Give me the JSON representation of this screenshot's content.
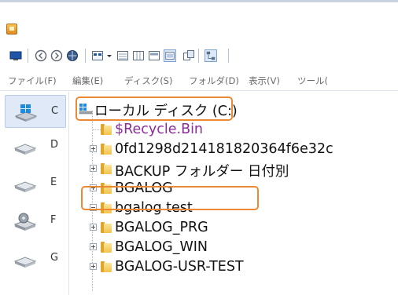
{
  "toolbar": {
    "icons": [
      "monitor-icon",
      "back-icon",
      "forward-icon",
      "globe-icon",
      "view-icon",
      "dropdown-icon",
      "view-list-icon",
      "view-details-icon",
      "view-small-icon",
      "view-large-icon",
      "copy-icon",
      "network-icon"
    ]
  },
  "menu": {
    "items": [
      "ファイル(F)",
      "編集(E)",
      "ディスク(S)",
      "フォルダ(D)",
      "表示(V)",
      "ツール("
    ]
  },
  "drives": [
    {
      "letter": "C",
      "icon": "windows-drive-icon",
      "selected": true
    },
    {
      "letter": "D",
      "icon": "hard-drive-icon",
      "selected": false
    },
    {
      "letter": "E",
      "icon": "hard-drive-icon",
      "selected": false
    },
    {
      "letter": "F",
      "icon": "dvd-drive-icon",
      "selected": false
    },
    {
      "letter": "G",
      "icon": "hard-drive-icon",
      "selected": false
    }
  ],
  "tree": {
    "root": {
      "label": "ローカル ディスク (C:)",
      "icon": "local-disk-icon"
    },
    "children": [
      {
        "label": "$Recycle.Bin",
        "expander": "none"
      },
      {
        "label": "0fd1298d214181820364f6e32c",
        "expander": "plus"
      },
      {
        "label": "BACKUP フォルダー 日付別",
        "expander": "plus"
      },
      {
        "label": "BGALOG",
        "expander": "plus"
      },
      {
        "label": "bgalog test",
        "expander": "minus"
      },
      {
        "label": "BGALOG_PRG",
        "expander": "plus"
      },
      {
        "label": "BGALOG_WIN",
        "expander": "plus"
      },
      {
        "label": "BGALOG-USR-TEST",
        "expander": "plus"
      }
    ]
  },
  "colors": {
    "highlight": "#ec8a33",
    "recycle_text": "#8b2c9a",
    "selected_drive_bg": "#dfe9f7"
  }
}
